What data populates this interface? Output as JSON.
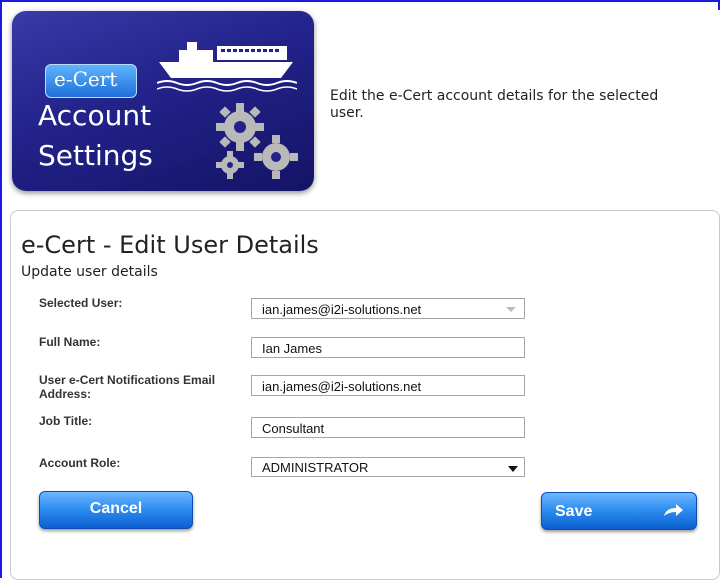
{
  "header": {
    "badge_text": "e-Cert",
    "title_line1": "Account",
    "title_line2": "Settings",
    "description": "Edit the e-Cert account details for the selected user."
  },
  "form": {
    "title": "e-Cert - Edit User Details",
    "subtitle": "Update user details",
    "selected_user": {
      "label": "Selected User:",
      "value": "ian.james@i2i-solutions.net"
    },
    "full_name": {
      "label": "Full Name:",
      "value": "Ian James"
    },
    "notification_email": {
      "label": "User e-Cert Notifications Email Address:",
      "value": "ian.james@i2i-solutions.net"
    },
    "job_title": {
      "label": "Job Title:",
      "value": "Consultant"
    },
    "account_role": {
      "label": "Account Role:",
      "value": "ADMINISTRATOR"
    },
    "cancel_label": "Cancel",
    "save_label": "Save"
  },
  "colors": {
    "frame_border": "#1a1ae0",
    "tile_bg": "#22228a",
    "button_blue": "#2f8ff1"
  },
  "icons": [
    "ship-icon",
    "gears-icon",
    "arrow-right-icon",
    "dropdown-arrow-icon"
  ]
}
